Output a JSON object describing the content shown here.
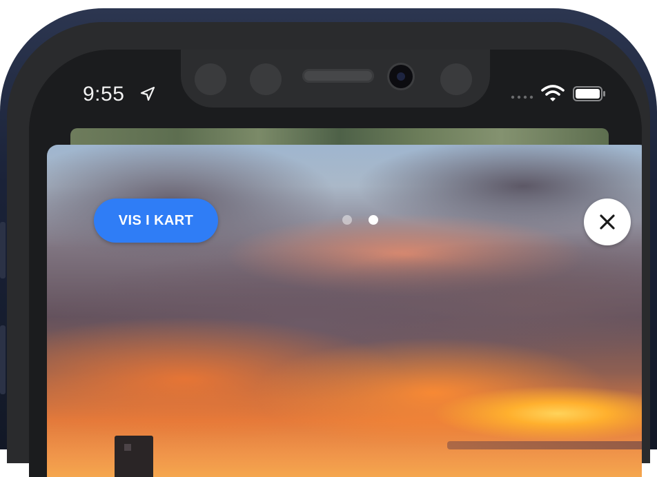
{
  "status_bar": {
    "time": "9:55",
    "location_icon": "location-arrow-icon",
    "signal_icon": "cellular-signal-icon",
    "wifi_icon": "wifi-icon",
    "battery_icon": "battery-icon"
  },
  "photo_viewer": {
    "show_map_label": "VIS I KART",
    "page_count": 2,
    "current_page": 2,
    "close_icon": "close-icon",
    "accent_color": "#2f7df6"
  }
}
